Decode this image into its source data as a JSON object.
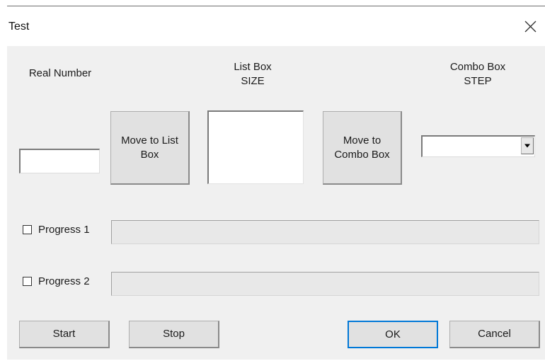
{
  "window": {
    "title": "Test",
    "close_icon": "close-icon"
  },
  "labels": {
    "real_number": "Real Number",
    "list_box_line1": "List Box",
    "list_box_line2": "SIZE",
    "combo_box_line1": "Combo Box",
    "combo_box_line2": "STEP"
  },
  "inputs": {
    "real_number_value": "",
    "list_box_items": [],
    "combo_box_value": "",
    "combo_arrow_icon": "chevron-down-icon"
  },
  "buttons": {
    "move_to_list_line1": "Move to List",
    "move_to_list_line2": "Box",
    "move_to_combo_line1": "Move to",
    "move_to_combo_line2": "Combo Box",
    "start": "Start",
    "stop": "Stop",
    "ok": "OK",
    "cancel": "Cancel"
  },
  "progress": [
    {
      "label": "Progress 1",
      "checked": false,
      "value": 0
    },
    {
      "label": "Progress 2",
      "checked": false,
      "value": 0
    }
  ]
}
